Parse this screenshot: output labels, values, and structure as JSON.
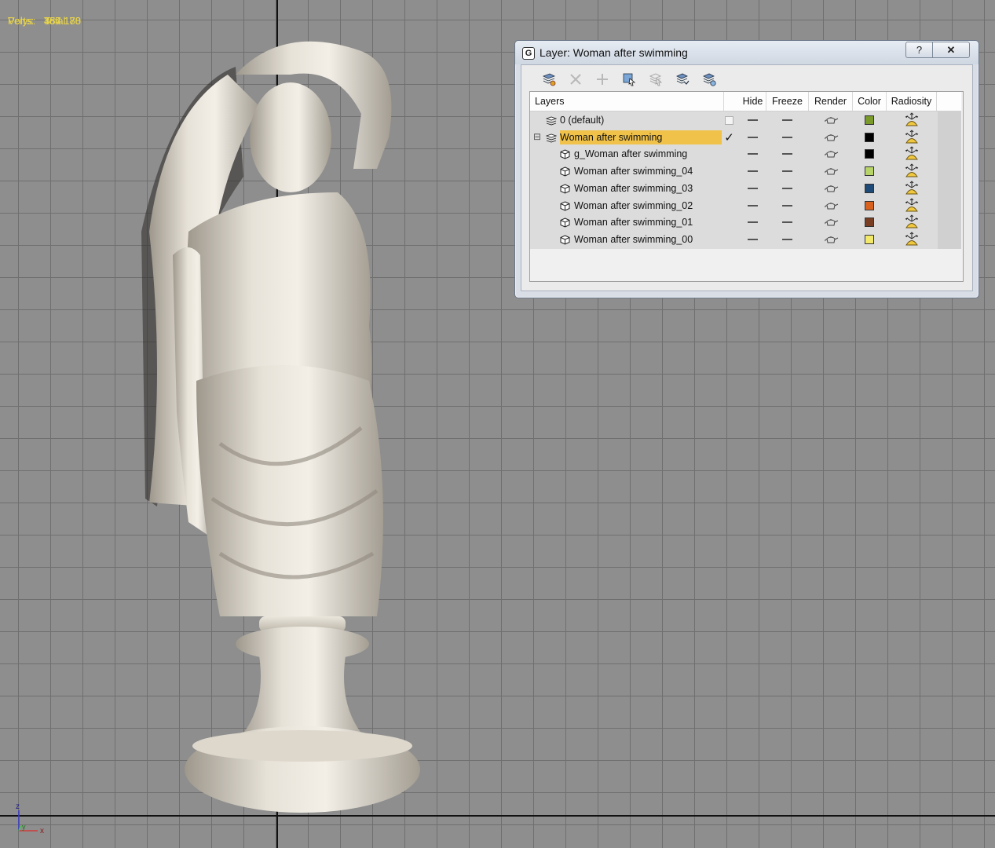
{
  "viewport": {
    "stats": {
      "header": "Total",
      "rows": [
        {
          "label": "Polys:",
          "value": "457 180"
        },
        {
          "label": "Verts:",
          "value": "384 178"
        }
      ]
    },
    "gizmo": {
      "z": "z",
      "y": "y",
      "x": "x"
    }
  },
  "dialog": {
    "title": "Layer: Woman after swimming",
    "app_icon": "G",
    "help_label": "?",
    "close_label": "✕",
    "toolbar_icons": [
      "new-layer-icon",
      "delete-layer-icon",
      "add-to-layer-icon",
      "select-objects-icon",
      "select-layer-icon",
      "hide-all-icon",
      "freeze-all-icon"
    ],
    "columns": {
      "layers": "Layers",
      "hide": "Hide",
      "freeze": "Freeze",
      "render": "Render",
      "color": "Color",
      "radiosity": "Radiosity"
    },
    "rows": [
      {
        "name": "0 (default)",
        "type": "layer",
        "indent": 1,
        "color": "#7a9a2a",
        "current": false,
        "selected": false
      },
      {
        "name": "Woman after swimming",
        "type": "layer",
        "indent": 1,
        "color": "#000000",
        "current": true,
        "selected": true,
        "expander": "⊟"
      },
      {
        "name": "g_Woman after swimming",
        "type": "object",
        "indent": 2,
        "color": "#000000",
        "current": false,
        "selected": false
      },
      {
        "name": "Woman after swimming_04",
        "type": "object",
        "indent": 2,
        "color": "#b7d468",
        "current": false,
        "selected": false
      },
      {
        "name": "Woman after swimming_03",
        "type": "object",
        "indent": 2,
        "color": "#1e4a78",
        "current": false,
        "selected": false
      },
      {
        "name": "Woman after swimming_02",
        "type": "object",
        "indent": 2,
        "color": "#d9611e",
        "current": false,
        "selected": false
      },
      {
        "name": "Woman after swimming_01",
        "type": "object",
        "indent": 2,
        "color": "#7a3e22",
        "current": false,
        "selected": false
      },
      {
        "name": "Woman after swimming_00",
        "type": "object",
        "indent": 2,
        "color": "#f2e86a",
        "current": false,
        "selected": false
      }
    ],
    "accent_selected": "#f0c24a"
  }
}
